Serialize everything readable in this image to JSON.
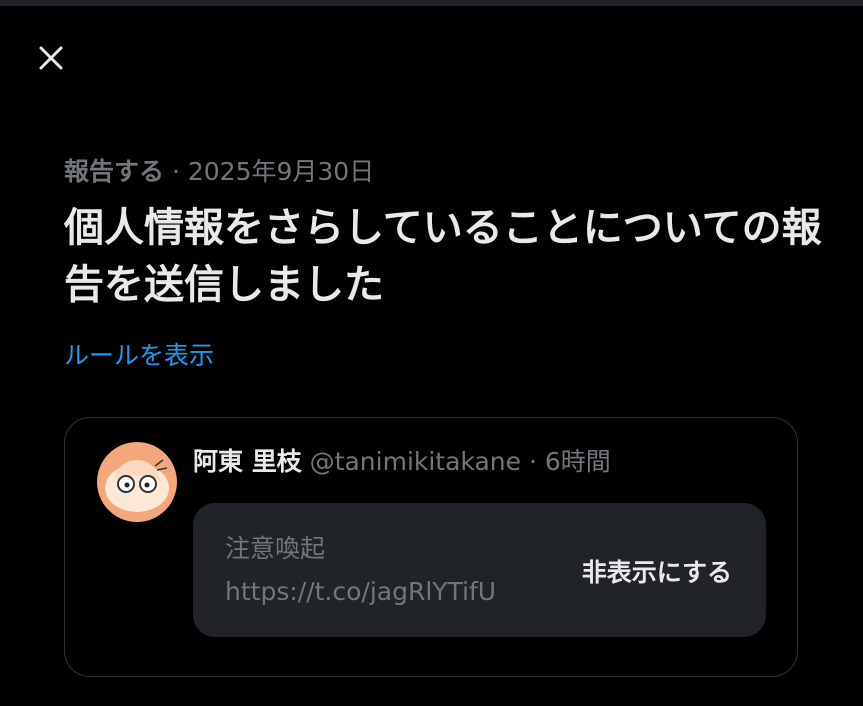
{
  "close_icon": "close-icon",
  "report": {
    "kind": "報告する",
    "separator": "·",
    "date": "2025年9月30日",
    "title": "個人情報をさらしていることについての報告を送信しました",
    "rules_link": "ルールを表示"
  },
  "post": {
    "author_name": "阿東 里枝",
    "author_handle": "@tanimikitakane",
    "separator": "·",
    "time": "6時間",
    "notice_label": "注意喚起",
    "notice_link": "https://t.co/jagRlYTifU",
    "hide_button": "非表示にする"
  },
  "colors": {
    "background": "#000000",
    "accent": "#1d9bf0",
    "muted": "#71767b",
    "card_border": "#2f3336",
    "notice_bg": "#202327"
  }
}
